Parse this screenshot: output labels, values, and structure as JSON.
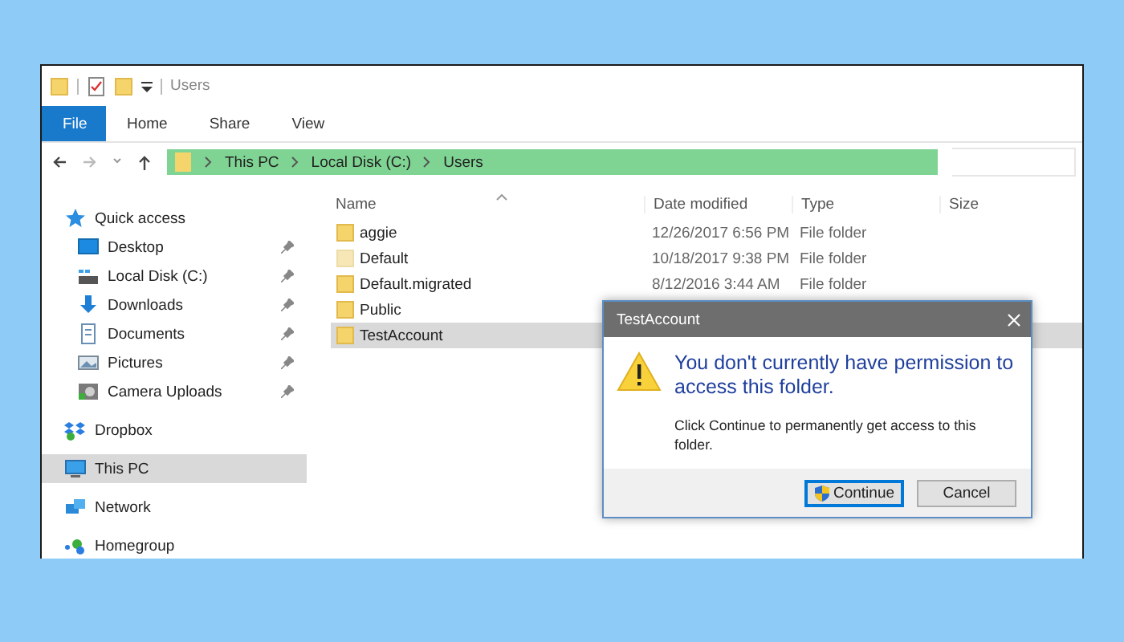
{
  "window": {
    "title": "Users"
  },
  "ribbon": {
    "file_tab": "File",
    "tabs": [
      "Home",
      "Share",
      "View"
    ]
  },
  "address_bar": {
    "path": [
      "This PC",
      "Local Disk (C:)",
      "Users"
    ]
  },
  "sidebar": {
    "items": [
      {
        "label": "Quick access",
        "kind": "header",
        "pinned": false,
        "selected": false
      },
      {
        "label": "Desktop",
        "kind": "item",
        "pinned": true,
        "selected": false
      },
      {
        "label": "Local Disk (C:)",
        "kind": "item",
        "pinned": true,
        "selected": false
      },
      {
        "label": "Downloads",
        "kind": "item",
        "pinned": true,
        "selected": false
      },
      {
        "label": "Documents",
        "kind": "item",
        "pinned": true,
        "selected": false
      },
      {
        "label": "Pictures",
        "kind": "item",
        "pinned": true,
        "selected": false
      },
      {
        "label": "Camera Uploads",
        "kind": "item",
        "pinned": true,
        "selected": false
      },
      {
        "label": "Dropbox",
        "kind": "header",
        "pinned": false,
        "selected": false
      },
      {
        "label": "This PC",
        "kind": "header",
        "pinned": false,
        "selected": true
      },
      {
        "label": "Network",
        "kind": "header",
        "pinned": false,
        "selected": false
      },
      {
        "label": "Homegroup",
        "kind": "header",
        "pinned": false,
        "selected": false
      }
    ]
  },
  "file_list": {
    "columns": [
      "Name",
      "Date modified",
      "Type",
      "Size"
    ],
    "rows": [
      {
        "name": "aggie",
        "date": "12/26/2017 6:56 PM",
        "type": "File folder",
        "selected": false
      },
      {
        "name": "Default",
        "date": "10/18/2017 9:38 PM",
        "type": "File folder",
        "selected": false
      },
      {
        "name": "Default.migrated",
        "date": "8/12/2016 3:44 AM",
        "type": "File folder",
        "selected": false
      },
      {
        "name": "Public",
        "selected": false
      },
      {
        "name": "TestAccount",
        "selected": true
      }
    ]
  },
  "dialog": {
    "title": "TestAccount",
    "heading": "You don't currently have permission to access this folder.",
    "message": "Click Continue to permanently get access to this folder.",
    "buttons": [
      {
        "label": "Continue",
        "kind": "elevated",
        "default": true
      },
      {
        "label": "Cancel",
        "kind": "plain",
        "default": false
      }
    ]
  }
}
